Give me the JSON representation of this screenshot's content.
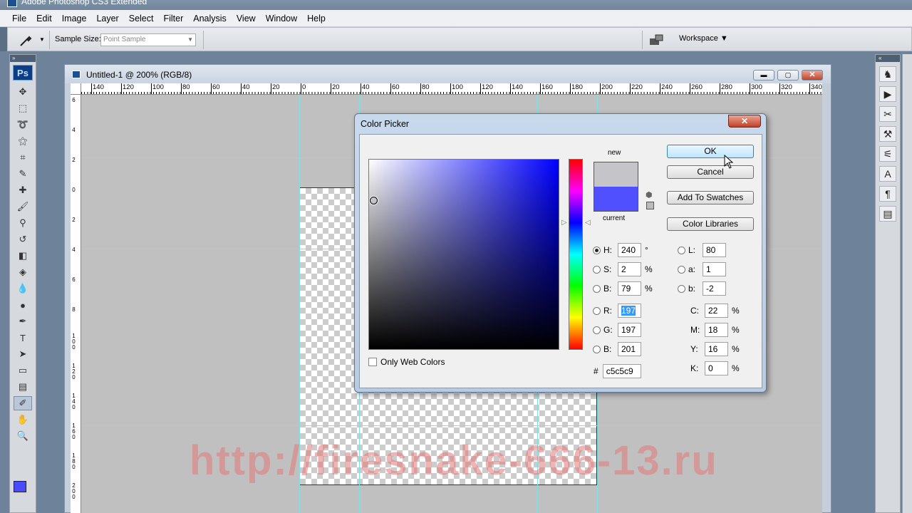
{
  "app_title": "Adobe Photoshop CS3 Extended",
  "menu": [
    "File",
    "Edit",
    "Image",
    "Layer",
    "Select",
    "Filter",
    "Analysis",
    "View",
    "Window",
    "Help"
  ],
  "options": {
    "sample_size_label": "Sample Size:",
    "sample_size_value": "Point Sample",
    "workspace_label": "Workspace ▼"
  },
  "document": {
    "title": "Untitled-1 @ 200% (RGB/8)",
    "ruler_h": [
      "140",
      "120",
      "100",
      "80",
      "60",
      "40",
      "20",
      "0",
      "20",
      "40",
      "60",
      "80",
      "100",
      "120",
      "140",
      "160",
      "180",
      "200",
      "220",
      "240",
      "260",
      "280",
      "300",
      "320",
      "340"
    ],
    "ruler_v": [
      "6",
      "4",
      "2",
      "0",
      "2",
      "4",
      "6",
      "8",
      "1 0 0",
      "1 2 0",
      "1 4 0",
      "1 6 0",
      "1 8 0",
      "2 0 0"
    ],
    "watermark": "http://firesnake-666-13.ru"
  },
  "toolbox": {
    "logo": "Ps",
    "fg_color": "#4a4aff"
  },
  "color_picker": {
    "title": "Color Picker",
    "close_glyph": "✕",
    "label_new": "new",
    "label_current": "current",
    "new_color": "#c5c5c9",
    "current_color": "#5050ff",
    "buttons": {
      "ok": "OK",
      "cancel": "Cancel",
      "add_to_swatches": "Add To Swatches",
      "color_libraries": "Color Libraries"
    },
    "hsb": [
      {
        "label": "H:",
        "value": "240",
        "unit": "°",
        "selected": true
      },
      {
        "label": "S:",
        "value": "2",
        "unit": "%",
        "selected": false
      },
      {
        "label": "B:",
        "value": "79",
        "unit": "%",
        "selected": false
      }
    ],
    "rgb": [
      {
        "label": "R:",
        "value": "197"
      },
      {
        "label": "G:",
        "value": "197"
      },
      {
        "label": "B:",
        "value": "201"
      }
    ],
    "lab": [
      {
        "label": "L:",
        "value": "80"
      },
      {
        "label": "a:",
        "value": "1"
      },
      {
        "label": "b:",
        "value": "-2"
      }
    ],
    "cmyk": [
      {
        "label": "C:",
        "value": "22",
        "unit": "%"
      },
      {
        "label": "M:",
        "value": "18",
        "unit": "%"
      },
      {
        "label": "Y:",
        "value": "16",
        "unit": "%"
      },
      {
        "label": "K:",
        "value": "0",
        "unit": "%"
      }
    ],
    "hex_label": "#",
    "hex_value": "c5c5c9",
    "only_web_colors": "Only Web Colors"
  }
}
